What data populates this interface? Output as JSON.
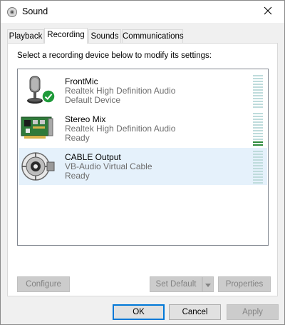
{
  "window": {
    "title": "Sound",
    "icon": "speaker-icon",
    "close_icon": "close-icon"
  },
  "tabs": [
    {
      "label": "Playback",
      "active": false
    },
    {
      "label": "Recording",
      "active": true
    },
    {
      "label": "Sounds",
      "active": false
    },
    {
      "label": "Communications",
      "active": false
    }
  ],
  "recording": {
    "instructions": "Select a recording device below to modify its settings:",
    "devices": [
      {
        "name": "FrontMic",
        "description": "Realtek High Definition Audio",
        "status": "Default Device",
        "icon": "microphone-icon",
        "badge": "default-check-icon",
        "selected": false,
        "level": 0.0
      },
      {
        "name": "Stereo Mix",
        "description": "Realtek High Definition Audio",
        "status": "Ready",
        "icon": "sound-card-icon",
        "selected": false,
        "level": 0.2
      },
      {
        "name": "CABLE Output",
        "description": "VB-Audio Virtual Cable",
        "status": "Ready",
        "icon": "cable-icon",
        "selected": true,
        "level": 0.0
      }
    ],
    "buttons": {
      "configure": "Configure",
      "set_default": "Set Default",
      "properties": "Properties"
    }
  },
  "footer": {
    "ok": "OK",
    "cancel": "Cancel",
    "apply": "Apply"
  },
  "colors": {
    "accent": "#0078d7",
    "selection": "#e5f1fb",
    "meter_idle": "#bfdcdc",
    "meter_active": "#2e8b3d",
    "check": "#1f9a3a"
  }
}
